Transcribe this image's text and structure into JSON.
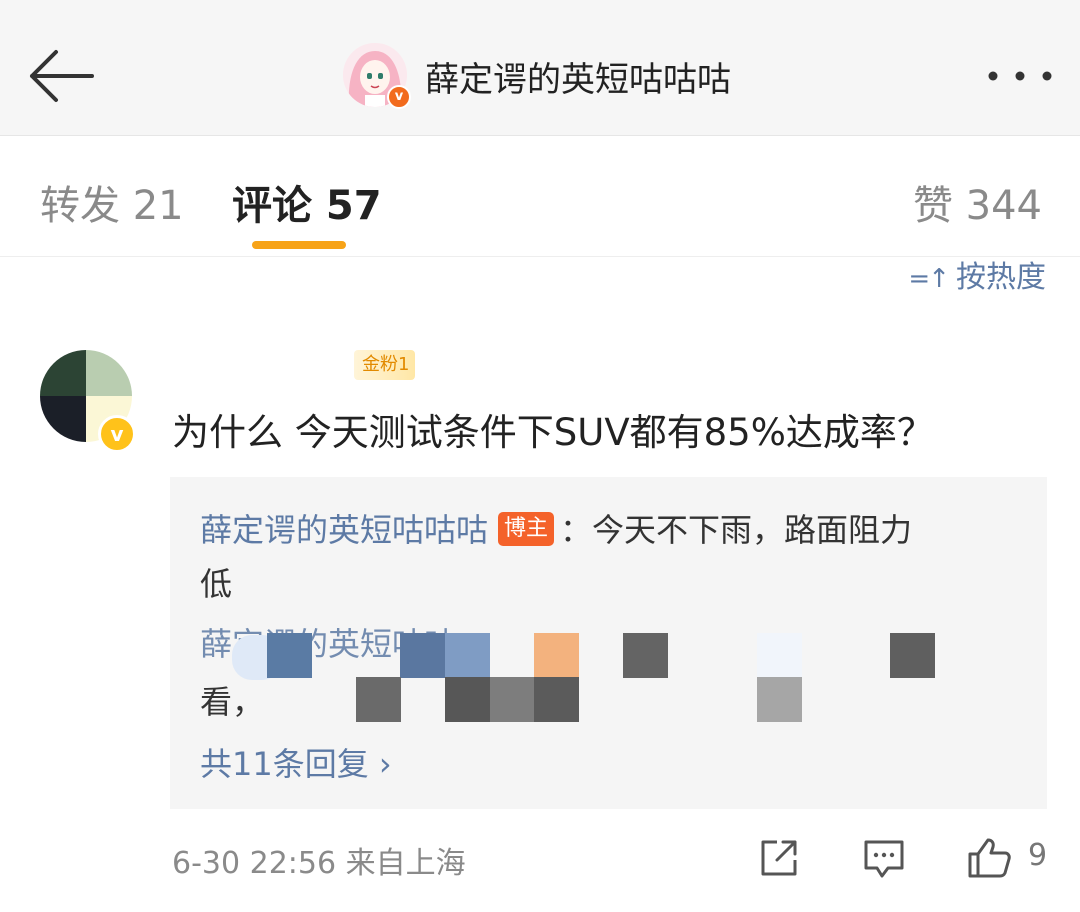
{
  "header": {
    "title": "薛定谔的英短咕咕咕",
    "avatar_badge": "v",
    "back_icon": "arrow-left-icon",
    "more_icon": "more-horizontal-icon"
  },
  "tabs": {
    "reposts": "转发 21",
    "comments": "评论 57",
    "likes": "赞 344",
    "active_color": "#f7a318"
  },
  "sort": {
    "label": "按热度",
    "icon": "sort-icon"
  },
  "comment": {
    "fan_badge": "金粉1",
    "avatar_badge": "v",
    "text": "为什么 今天测试条件下SUV都有85%达成率？",
    "reply_box": {
      "reply1": {
        "author": "薛定谔的英短咕咕咕",
        "badge": "博主",
        "text_line1": "：今天不下雨，路面阻力",
        "text_line2": "低"
      },
      "reply2": {
        "author_partial": "薛定谔的英短咕咕",
        "text_partial": "看，"
      },
      "view_all": "共11条回复 ›"
    },
    "meta": "6-30 22:56 来自上海",
    "actions": {
      "share_icon": "share-icon",
      "reply_icon": "comment-icon",
      "like_icon": "thumbs-up-icon",
      "like_count": "9"
    }
  },
  "colors": {
    "link_blue": "#5d7aa5",
    "host_badge": "#f4622a",
    "fan_badge_text": "#e28a00"
  }
}
